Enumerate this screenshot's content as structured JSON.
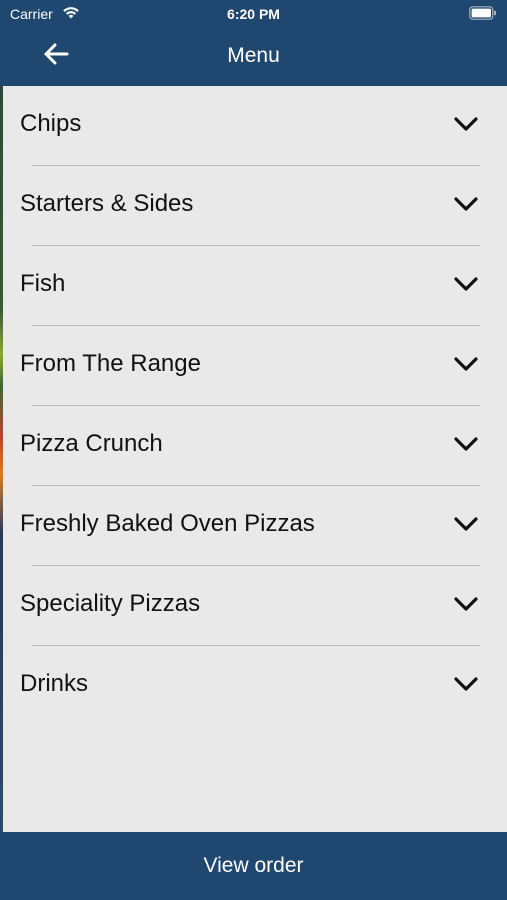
{
  "status_bar": {
    "carrier": "Carrier",
    "time": "6:20 PM"
  },
  "nav": {
    "back_icon": "arrow-left-icon",
    "title": "Menu"
  },
  "menu": {
    "items": [
      {
        "label": "Chips"
      },
      {
        "label": "Starters & Sides"
      },
      {
        "label": "Fish"
      },
      {
        "label": "From The Range"
      },
      {
        "label": "Pizza Crunch"
      },
      {
        "label": "Freshly Baked Oven Pizzas"
      },
      {
        "label": "Speciality Pizzas"
      },
      {
        "label": "Drinks"
      }
    ],
    "item_icon": "chevron-down-icon"
  },
  "footer": {
    "view_order_label": "View order"
  },
  "colors": {
    "brand": "#1f4770",
    "list_background": "#e9e9e9",
    "divider": "#b8b8b8"
  }
}
